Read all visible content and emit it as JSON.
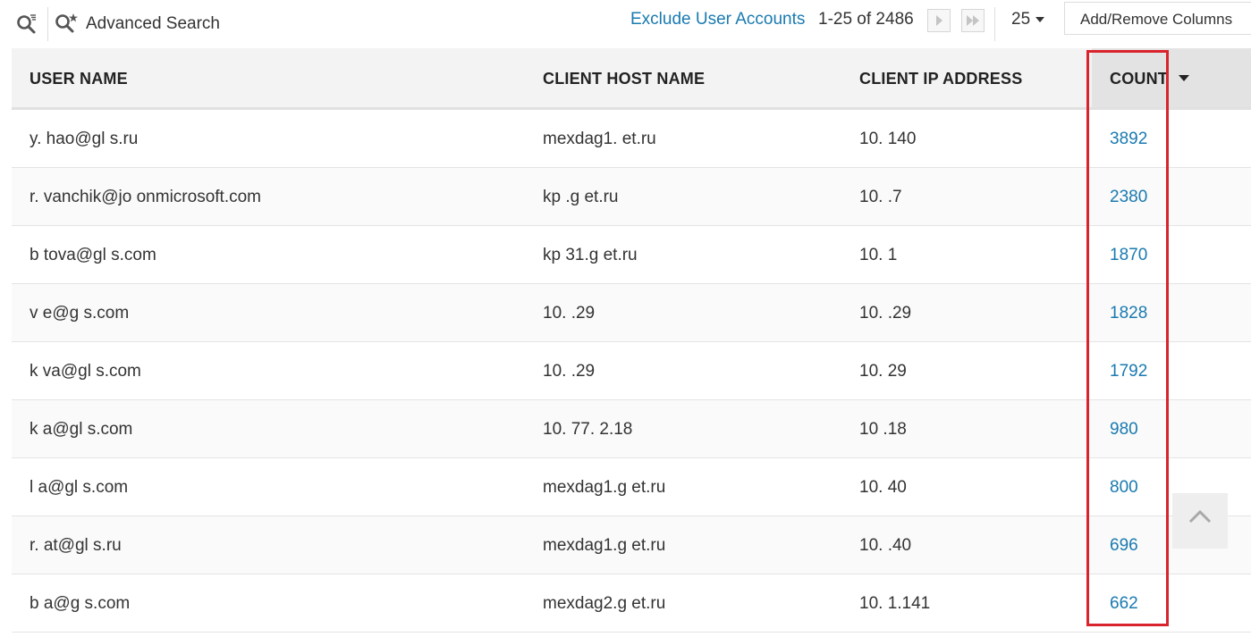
{
  "toolbar": {
    "search_icon": "search-filter-icon",
    "advanced_search_icon": "advanced-search-icon",
    "advanced_search_label": "Advanced Search",
    "exclude_link": "Exclude User Accounts",
    "pager_range": "1-25 of 2486",
    "next_icon": "play-next-icon",
    "last_icon": "fast-forward-icon",
    "page_size": "25",
    "columns_button": "Add/Remove Columns"
  },
  "table": {
    "columns": [
      "USER NAME",
      "CLIENT HOST NAME",
      "CLIENT IP ADDRESS",
      "COUNT"
    ],
    "sorted_column": "COUNT",
    "rows": [
      {
        "user": "y.      hao@gl      s.ru",
        "host": "mexdag1.       et.ru",
        "ip": "10.      140",
        "count": "3892"
      },
      {
        "user": "r.   vanchik@jo           onmicrosoft.com",
        "host": "kp       .g        et.ru",
        "ip": "10.    .7",
        "count": "2380"
      },
      {
        "user": "b     tova@gl       s.com",
        "host": "kp    31.g       et.ru",
        "ip": "10.      1",
        "count": "1870"
      },
      {
        "user": "v   e@g       s.com",
        "host": "10.    .29",
        "ip": "10.      .29",
        "count": "1828"
      },
      {
        "user": "k     va@gl       s.com",
        "host": "10.    .29",
        "ip": "10.      29",
        "count": "1792"
      },
      {
        "user": "k      a@gl       s.com",
        "host": "10.  77.  2.18",
        "ip": "10      .18",
        "count": "980"
      },
      {
        "user": "l      a@gl       s.com",
        "host": "mexdag1.g       et.ru",
        "ip": "10.      40",
        "count": "800"
      },
      {
        "user": "r.      at@gl       s.ru",
        "host": "mexdag1.g       et.ru",
        "ip": "10.      .40",
        "count": "696"
      },
      {
        "user": "b      a@g       s.com",
        "host": "mexdag2.g       et.ru",
        "ip": "10.     1.141",
        "count": "662"
      }
    ]
  },
  "scroll_top_icon": "chevron-up-icon",
  "colors": {
    "link": "#1a7ab0",
    "highlight": "#d9232d",
    "header_bg": "#f3f3f3"
  }
}
